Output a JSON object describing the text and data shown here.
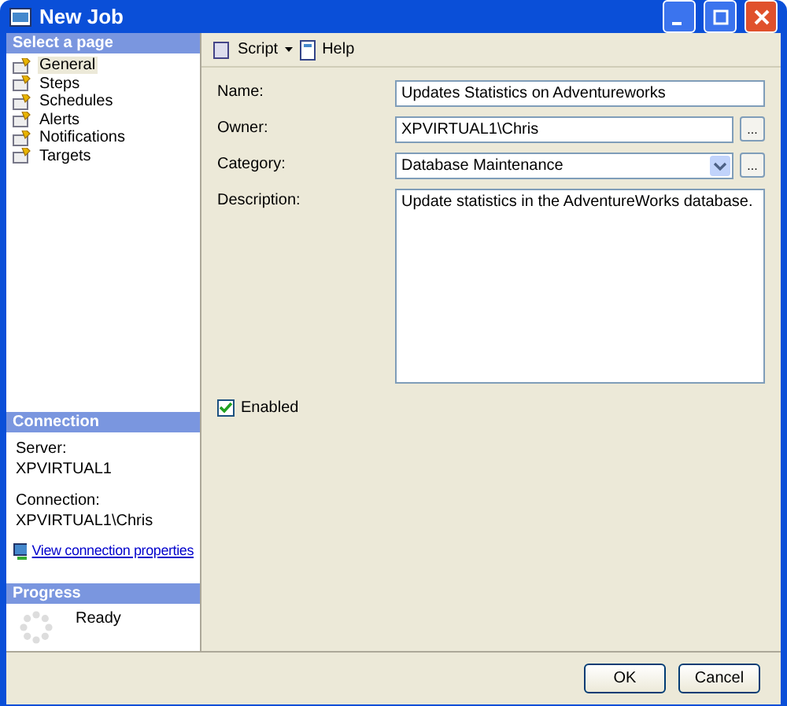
{
  "window": {
    "title": "New Job"
  },
  "sidebar": {
    "header": "Select a page",
    "items": [
      {
        "label": "General",
        "selected": true
      },
      {
        "label": "Steps",
        "selected": false
      },
      {
        "label": "Schedules",
        "selected": false
      },
      {
        "label": "Alerts",
        "selected": false
      },
      {
        "label": "Notifications",
        "selected": false
      },
      {
        "label": "Targets",
        "selected": false
      }
    ]
  },
  "connection": {
    "header": "Connection",
    "server_label": "Server:",
    "server": "XPVIRTUAL1",
    "connection_label": "Connection:",
    "connection": "XPVIRTUAL1\\Chris",
    "link": "View connection properties"
  },
  "progress": {
    "header": "Progress",
    "status": "Ready"
  },
  "toolbar": {
    "script": "Script",
    "help": "Help"
  },
  "form": {
    "name_label": "Name:",
    "name": "Updates Statistics on Adventureworks",
    "owner_label": "Owner:",
    "owner": "XPVIRTUAL1\\Chris",
    "browse": "...",
    "category_label": "Category:",
    "category": "Database Maintenance",
    "description_label": "Description:",
    "description": "Update statistics in the AdventureWorks database.",
    "enabled_label": "Enabled",
    "enabled": true
  },
  "buttons": [
    "OK",
    "Cancel"
  ]
}
